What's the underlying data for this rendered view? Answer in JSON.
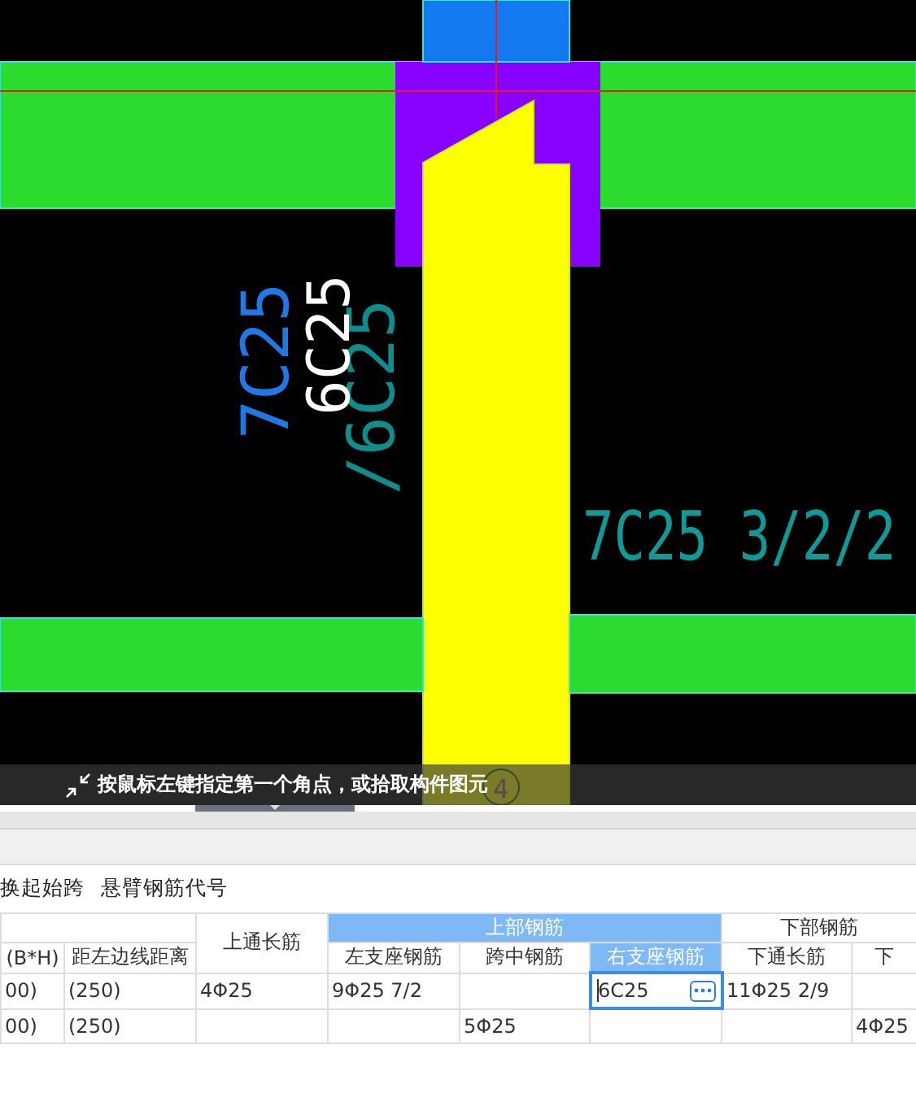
{
  "canvas": {
    "annotations": [
      {
        "text": "7C25",
        "kind": "vertical",
        "color": "#1e78e6"
      },
      {
        "text": "6C25",
        "kind": "vertical",
        "color": "#ffffff"
      },
      {
        "text": "/6C25",
        "kind": "vertical",
        "color": "#0f8c8c"
      },
      {
        "text": "7C25 3/2/2",
        "kind": "horizontal",
        "color": "#0f9a9a"
      }
    ],
    "axis_label": "4"
  },
  "status_bar": {
    "prompt": "按鼠标左键指定第一个角点，或拾取构件图元"
  },
  "toolbar": {
    "buttons": [
      "换起始跨",
      "悬臂钢筋代号"
    ]
  },
  "table": {
    "groups": [
      {
        "label": "上部钢筋",
        "selected": true
      },
      {
        "label": "下部钢筋",
        "selected": false
      }
    ],
    "columns": [
      {
        "label": "(B*H)",
        "selected": false
      },
      {
        "label": "距左边线距离",
        "selected": false
      },
      {
        "label": "上通长筋",
        "selected": false
      },
      {
        "label": "左支座钢筋",
        "selected": false
      },
      {
        "label": "跨中钢筋",
        "selected": false
      },
      {
        "label": "右支座钢筋",
        "selected": true
      },
      {
        "label": "下通长筋",
        "selected": false
      },
      {
        "label": "下",
        "selected": false
      }
    ],
    "rows": [
      {
        "cells": [
          {
            "text": "00)",
            "editing": false
          },
          {
            "text": "(250)",
            "editing": false
          },
          {
            "text": "4Φ25",
            "editing": false
          },
          {
            "text": "9Φ25 7/2",
            "editing": false
          },
          {
            "text": "",
            "editing": false
          },
          {
            "text": "6C25",
            "editing": true
          },
          {
            "text": "11Φ25 2/9",
            "editing": false
          },
          {
            "text": "",
            "editing": false
          }
        ]
      },
      {
        "cells": [
          {
            "text": "00)",
            "editing": false
          },
          {
            "text": "(250)",
            "editing": false
          },
          {
            "text": "",
            "editing": false
          },
          {
            "text": "",
            "editing": false
          },
          {
            "text": "5Φ25",
            "editing": false
          },
          {
            "text": "",
            "editing": false
          },
          {
            "text": "",
            "editing": false
          },
          {
            "text": "4Φ25",
            "editing": false
          }
        ]
      }
    ]
  }
}
